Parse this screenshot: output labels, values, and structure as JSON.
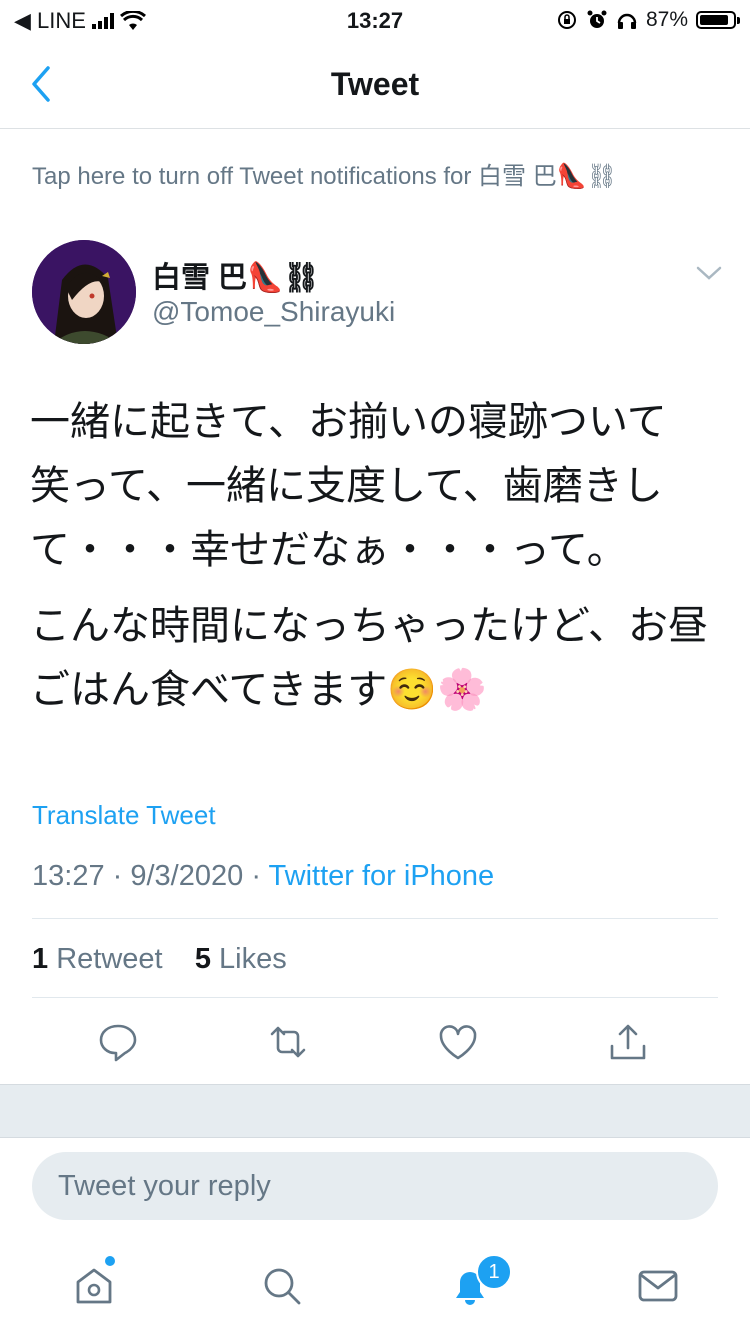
{
  "status_bar": {
    "carrier": "◀ LINE",
    "time": "13:27",
    "battery": "87%",
    "battery_level": 0.87
  },
  "header": {
    "title": "Tweet"
  },
  "notification_prompt": "Tap here to turn off Tweet notifications for 白雪 巴👠⛓",
  "tweet": {
    "author_name": "白雪 巴👠⛓",
    "author_handle": "@Tomoe_Shirayuki",
    "paragraphs": [
      "一緒に起きて、お揃いの寝跡ついて\n笑って、一緒に支度して、歯磨きして・・・幸せだなぁ・・・って。",
      "こんな時間になっちゃったけど、お昼ごはん食べてきます☺️🌸"
    ],
    "translate_label": "Translate Tweet",
    "time": "13:27",
    "date": "9/3/2020",
    "source": "Twitter for iPhone",
    "retweets": "1",
    "retweets_label": "Retweet",
    "likes": "5",
    "likes_label": "Likes"
  },
  "actions": [
    "reply-icon",
    "retweet-icon",
    "like-icon",
    "share-icon"
  ],
  "reply_box": {
    "placeholder": "Tweet your reply"
  },
  "tab_bar": {
    "items": [
      "home-icon",
      "search-icon",
      "notifications-icon",
      "messages-icon"
    ],
    "notification_badge": "1"
  },
  "colors": {
    "accent": "#1da1f2",
    "secondary_text": "#657786",
    "divider": "#e1e8ed"
  }
}
